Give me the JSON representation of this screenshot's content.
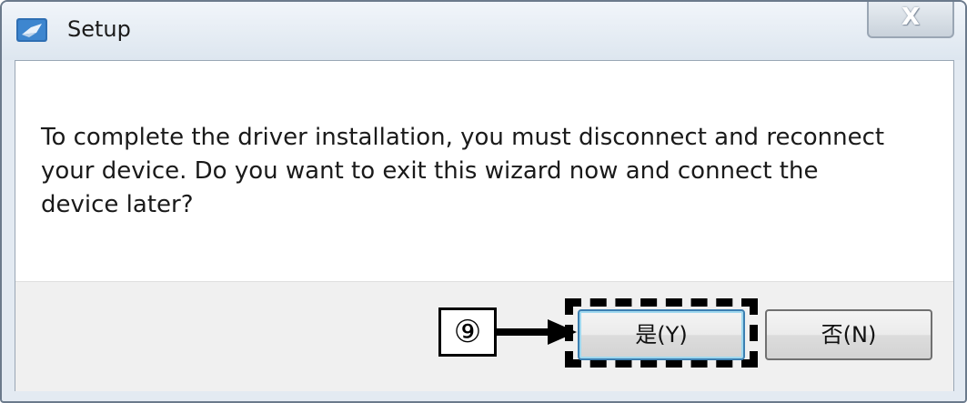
{
  "window": {
    "title": "Setup",
    "close_label": "X",
    "icon": "setup-app-icon"
  },
  "message": "To complete the driver installation, you must disconnect and reconnect your device. Do you want to exit this wizard now and connect the device later?",
  "annotation": {
    "step_label": "⑨"
  },
  "buttons": {
    "yes_label": "是(Y)",
    "no_label": "否(N)"
  }
}
